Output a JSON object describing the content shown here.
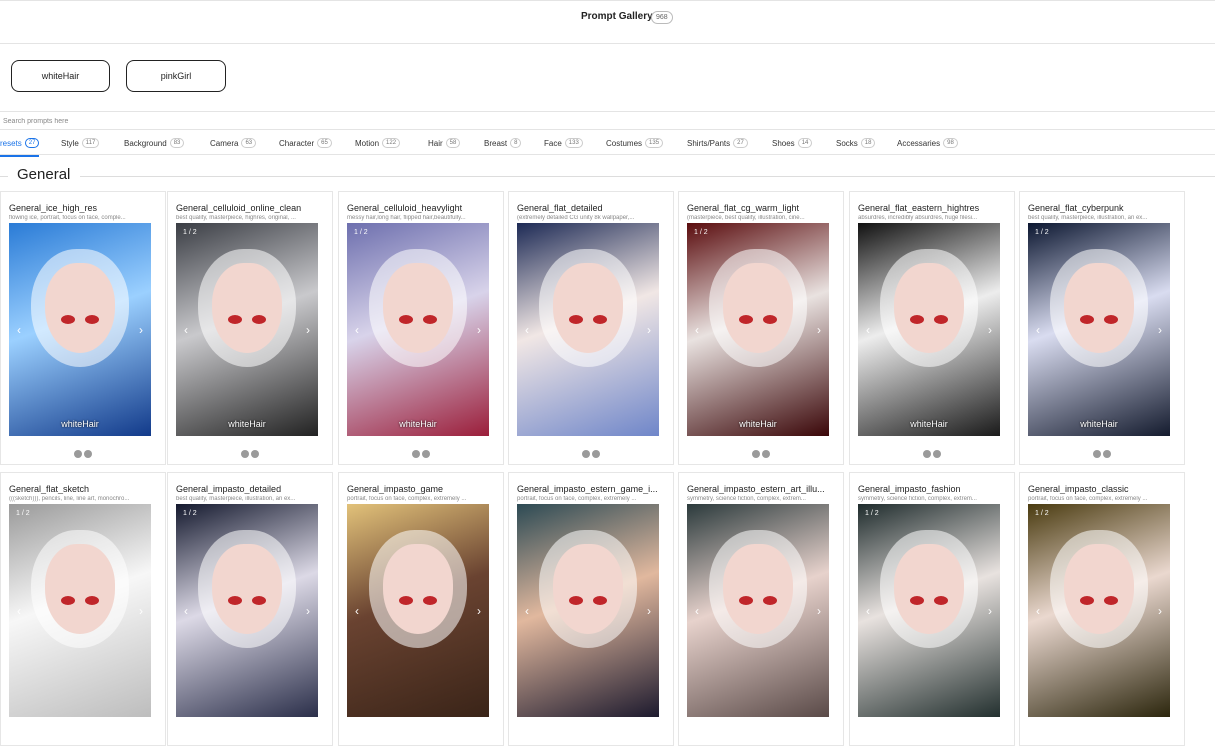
{
  "header": {
    "title": "Prompt Gallery",
    "count": "968"
  },
  "quick_buttons": [
    {
      "label": "whiteHair"
    },
    {
      "label": "pinkGirl"
    }
  ],
  "search": {
    "placeholder": "Search prompts here"
  },
  "tabs": [
    {
      "label": "resets",
      "count": "27",
      "active": true
    },
    {
      "label": "Style",
      "count": "117"
    },
    {
      "label": "Background",
      "count": "83"
    },
    {
      "label": "Camera",
      "count": "63"
    },
    {
      "label": "Character",
      "count": "65"
    },
    {
      "label": "Motion",
      "count": "122"
    },
    {
      "label": "Hair",
      "count": "58"
    },
    {
      "label": "Breast",
      "count": "8"
    },
    {
      "label": "Face",
      "count": "133"
    },
    {
      "label": "Costumes",
      "count": "135"
    },
    {
      "label": "Shirts/Pants",
      "count": "27"
    },
    {
      "label": "Shoes",
      "count": "14"
    },
    {
      "label": "Socks",
      "count": "18"
    },
    {
      "label": "Accessaries",
      "count": "98"
    }
  ],
  "section": {
    "title": "General"
  },
  "colors": {
    "accent": "#1a73e8",
    "card_border": "#e6e6e6",
    "dot": "#9a9a9a"
  },
  "cards": [
    {
      "title": "General_ice_high_res",
      "desc": "flowing ice, portrait, focus on face, comple...",
      "page": "",
      "label": "whiteHair",
      "has_dots": true,
      "bg": "linear-gradient(160deg,#2a7bd6 0%,#9bd0ff 45%,#123a8a 100%)"
    },
    {
      "title": "General_celluloid_online_clean",
      "desc": "best quality, masterpiece, highres, original, ...",
      "page": "1 / 2",
      "label": "whiteHair",
      "has_dots": true,
      "bg": "linear-gradient(160deg,#3a3d44 0%,#c9c9cc 45%,#222 100%)"
    },
    {
      "title": "General_celluloid_heavylight",
      "desc": "messy hair,long hair, flipped hair,beautifully...",
      "page": "1 / 2",
      "label": "whiteHair",
      "has_dots": true,
      "bg": "linear-gradient(160deg,#6d6fae 0%,#d8d3ea 45%,#9b1e3a 100%)"
    },
    {
      "title": "General_flat_detailed",
      "desc": "(extremely detailed CG unity 8k wallpaper,...",
      "page": "",
      "label": "",
      "has_dots": true,
      "bg": "linear-gradient(160deg,#1d2a55 0%,#f1e7e5 45%,#6f86c9 100%)"
    },
    {
      "title": "General_flat_cg_warm_light",
      "desc": "(masterpiece, best quality, illustration, cine...",
      "page": "1 / 2",
      "label": "whiteHair",
      "has_dots": true,
      "bg": "linear-gradient(160deg,#5a0c0e 0%,#e9e2e0 45%,#3a0608 100%)"
    },
    {
      "title": "General_flat_eastern_hightres",
      "desc": "absurdres, incredibly absurdres, huge filesi...",
      "page": "",
      "label": "whiteHair",
      "has_dots": true,
      "bg": "linear-gradient(160deg,#111 0%,#ededed 45%,#1a1a1a 100%)"
    },
    {
      "title": "General_flat_cyberpunk",
      "desc": "best quality, masterpiece, illustration, an ex...",
      "page": "1 / 2",
      "label": "whiteHair",
      "has_dots": true,
      "bg": "linear-gradient(160deg,#0b1630 0%,#d9dcf0 45%,#141b2e 100%)"
    },
    {
      "title": "General_flat_sketch",
      "desc": "(((sketch))), pencils, line, line art, monochro...",
      "page": "1 / 2",
      "label": "",
      "has_dots": false,
      "bg": "linear-gradient(160deg,#9a9a9a 0%,#f7f7f7 45%,#bdbdbd 100%)"
    },
    {
      "title": "General_impasto_detailed",
      "desc": "best quality, masterpiece, illustration, an ex...",
      "page": "1 / 2",
      "label": "",
      "has_dots": false,
      "bg": "linear-gradient(160deg,#14192e 0%,#dcd9e6 45%,#2b2f4a 100%)"
    },
    {
      "title": "General_impasto_game",
      "desc": "portrait, focus on face, complex, extremely ...",
      "page": "",
      "label": "",
      "has_dots": false,
      "bg": "linear-gradient(160deg,#e2c27a 0%,#6a4331 45%,#3a2418 100%)"
    },
    {
      "title": "General_impasto_estern_game_i...",
      "desc": "portrait, focus on face, complex, extremely ...",
      "page": "",
      "label": "",
      "has_dots": false,
      "bg": "linear-gradient(160deg,#2c4a54 0%,#e1b89e 45%,#1d1a2e 100%)"
    },
    {
      "title": "General_impasto_estern_art_illu...",
      "desc": "symmetry, science fiction, complex, extrem...",
      "page": "",
      "label": "",
      "has_dots": false,
      "bg": "linear-gradient(160deg,#2b3a3c 0%,#e7d2cc 45%,#5a4a48 100%)"
    },
    {
      "title": "General_impasto_fashion",
      "desc": "symmetry, science fiction, complex, extrem...",
      "page": "1 / 2",
      "label": "",
      "has_dots": false,
      "bg": "linear-gradient(160deg,#1e2b2c 0%,#e8e2df 45%,#23302f 100%)"
    },
    {
      "title": "General_impasto_classic",
      "desc": "portrait, focus on face, complex, extremely ...",
      "page": "1 / 2",
      "label": "",
      "has_dots": false,
      "bg": "linear-gradient(160deg,#4a3b10 0%,#ead8cf 45%,#2c260d 100%)"
    }
  ]
}
